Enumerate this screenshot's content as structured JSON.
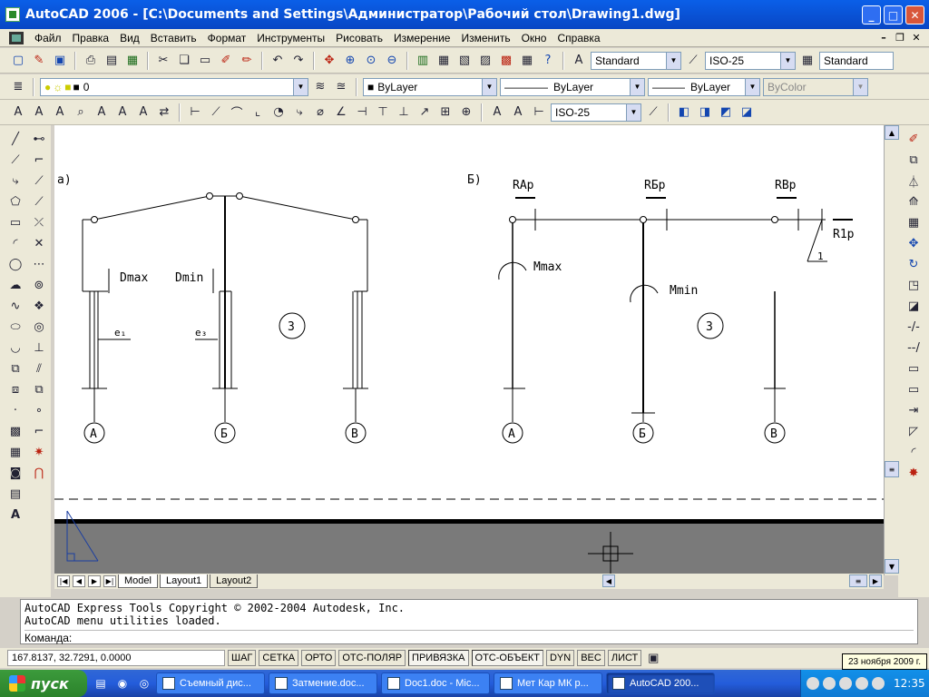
{
  "window": {
    "title": "AutoCAD 2006 - [C:\\Documents and Settings\\Администратор\\Рабочий стол\\Drawing1.dwg]",
    "minimize": "_",
    "maximize": "□",
    "close": "✕"
  },
  "menu": [
    "Файл",
    "Правка",
    "Вид",
    "Вставить",
    "Формат",
    "Инструменты",
    "Рисовать",
    "Измерение",
    "Изменить",
    "Окно",
    "Справка"
  ],
  "toolbar": {
    "text_style": "Standard",
    "dim_style": "ISO-25",
    "table_style": "Standard",
    "layer": "0",
    "color": "ByLayer",
    "linetype": "ByLayer",
    "lineweight": "ByLayer",
    "plotstyle": "ByColor",
    "dim_style2": "ISO-25"
  },
  "drawing": {
    "label_a": "а)",
    "label_b": "Б)",
    "dmax": "Dmax",
    "dmin": "Dmin",
    "e1": "e₁",
    "e3": "e₃",
    "circle3_a": "3",
    "circle3_b": "3",
    "axis_a1": "А",
    "axis_b1": "Б",
    "axis_v1": "В",
    "axis_a2": "А",
    "axis_b2": "Б",
    "axis_v2": "В",
    "rap": "RAp",
    "rbp": "RБp",
    "rvp": "RBp",
    "r1p": "R1p",
    "mmax": "Mmax",
    "mmin": "Mmin",
    "one": "1"
  },
  "tabs": [
    "Model",
    "Layout1",
    "Layout2"
  ],
  "active_tab": "Layout2",
  "command": {
    "line1": "AutoCAD Express Tools Copyright © 2002-2004 Autodesk, Inc.",
    "line2": "AutoCAD menu utilities loaded.",
    "prompt": "Команда:"
  },
  "status": {
    "coords": "167.8137, 32.7291, 0.0000",
    "buttons": [
      "ШАГ",
      "СЕТКА",
      "ОРТО",
      "ОТС-ПОЛЯР",
      "ПРИВЯЗКА",
      "ОТС-ОБЪЕКТ",
      "DYN",
      "ВЕС",
      "ЛИСТ"
    ]
  },
  "tooltip": "23 ноября 2009 г.",
  "taskbar": {
    "start": "пуск",
    "tasks": [
      "Съемный дис...",
      "Затмение.doc...",
      "Doc1.doc - Mic...",
      "Мет Кар МК р...",
      "AutoCAD 200..."
    ],
    "active_task": "AutoCAD 200...",
    "clock": "12:35"
  }
}
